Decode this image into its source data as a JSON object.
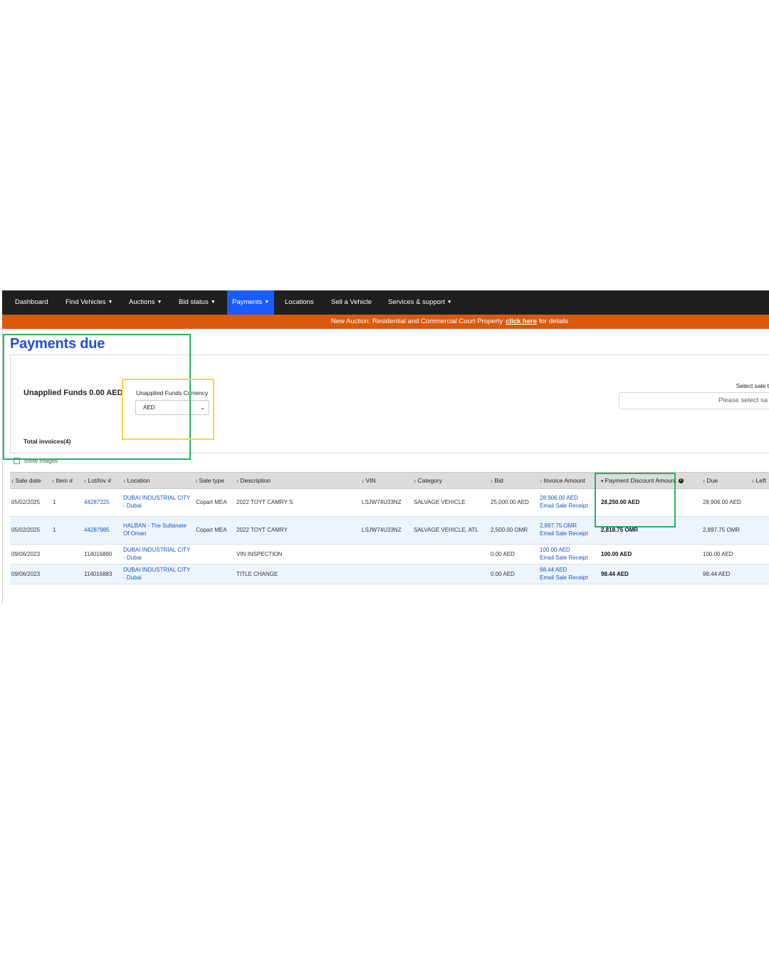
{
  "nav": {
    "items": [
      {
        "label": "Dashboard",
        "caret": false
      },
      {
        "label": "Find Vehicles",
        "caret": true
      },
      {
        "label": "Auctions",
        "caret": true
      },
      {
        "label": "Bid status",
        "caret": true
      },
      {
        "label": "Payments",
        "caret": true,
        "active": true
      },
      {
        "label": "Locations",
        "caret": false
      },
      {
        "label": "Sell a Vehicle",
        "caret": false
      },
      {
        "label": "Services & support",
        "caret": true
      }
    ],
    "caret_glyph": "▼"
  },
  "banner": {
    "text": "New Auction: Residential and Commercial Court Property",
    "link": "click here",
    "suffix": "for details"
  },
  "page": {
    "title": "Payments due"
  },
  "summary": {
    "unapplied_funds": "Unapplied Funds 0.00 AED",
    "currency_label": "Unapplied Funds Currency",
    "currency_value": "AED",
    "total_invoices": "Total invoices(4)",
    "select_sale_label": "Select sale t",
    "select_sale_placeholder": "Please select sa"
  },
  "show_images_label": "Show images",
  "table": {
    "headers": {
      "sale_date": "Sale date",
      "item": "Item #",
      "lot": "Lot/Inv #",
      "location": "Location",
      "sale_type": "Sale type",
      "description": "Description",
      "vin": "VIN",
      "category": "Category",
      "bid": "Bid",
      "invoice_amount": "Invoice Amount",
      "payment_discount": "Payment Discount Amount",
      "due": "Due",
      "left": "Left"
    },
    "rows": [
      {
        "sale_date": "05/02/2025",
        "item": "1",
        "lot": "44287325",
        "location_1": "DUBAI INDUSTRIAL CITY",
        "location_2": "- Dubai",
        "sale_type": "Copart MEA",
        "description": "2022 TOYT CAMRY S",
        "vin": "LSJW74U33NZ",
        "category": "SALVAGE VEHICLE",
        "bid": "25,000.00 AED",
        "invoice_amount": "28,906.00 AED",
        "receipt": "Email Sale Receipt",
        "payment_discount": "28,250.00 AED",
        "due": "28,906.00 AED"
      },
      {
        "sale_date": "05/02/2025",
        "item": "1",
        "lot": "44287985",
        "location_1": "HALBAN - The Sultanate",
        "location_2": "Of Oman",
        "sale_type": "Copart MEA",
        "description": "2022 TOYT CAMRY",
        "vin": "LSJW74U33NZ",
        "category": "SALVAGE VEHICLE, ATL",
        "bid": "2,500.00 OMR",
        "invoice_amount": "2,897.75 OMR",
        "receipt": "Email Sale Receipt",
        "payment_discount": "2,818.75 OMR",
        "due": "2,897.75 OMR"
      },
      {
        "sale_date": "09/06/2023",
        "item": "",
        "lot": "114016890",
        "location_1": "DUBAI INDUSTRIAL CITY",
        "location_2": "- Dubai",
        "sale_type": "",
        "description": "VIN INSPECTION",
        "vin": "",
        "category": "",
        "bid": "0.00 AED",
        "invoice_amount": "100.00 AED",
        "receipt": "Email Sale Receipt",
        "payment_discount": "100.00 AED",
        "due": "100.00 AED"
      },
      {
        "sale_date": "09/06/2023",
        "item": "",
        "lot": "114016883",
        "location_1": "DUBAI INDUSTRIAL CITY",
        "location_2": "- Dubai",
        "sale_type": "",
        "description": "TITLE CHANGE",
        "vin": "",
        "category": "",
        "bid": "0.00 AED",
        "invoice_amount": "98.44 AED",
        "receipt": "Email Sale Receipt",
        "payment_discount": "98.44 AED",
        "due": "98.44 AED"
      }
    ]
  },
  "colors": {
    "nav_bg": "#1f1f1f",
    "nav_active": "#1a5cff",
    "banner_bg": "#d9590f",
    "title": "#1f4fd8",
    "link": "#1a56c8",
    "highlight_green": "#22b36a",
    "highlight_yellow": "#f5d73f"
  }
}
